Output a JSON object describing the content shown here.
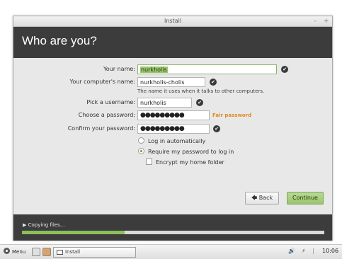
{
  "window": {
    "title": "Install",
    "minimize_glyph": "–",
    "close_glyph": "+"
  },
  "header": {
    "title": "Who are you?"
  },
  "form": {
    "name_label": "Your name:",
    "name_value": "nurkholis",
    "computer_label": "Your computer's name:",
    "computer_value": "nurkholis-cholis",
    "computer_hint": "The name it uses when it talks to other computers.",
    "username_label": "Pick a username:",
    "username_value": "nurkholis",
    "password_label": "Choose a password:",
    "password_value": "●●●●●●●●●",
    "password_strength": "Fair password",
    "confirm_label": "Confirm your password:",
    "confirm_value": "●●●●●●●●●",
    "login_auto_label": "Log in automatically",
    "login_require_label": "Require my password to log in",
    "encrypt_label": "Encrypt my home folder",
    "selected_login_option": "require_password",
    "encrypt_checked": false,
    "check_glyph": "✔"
  },
  "buttons": {
    "back_label": "Back",
    "back_glyph": "🡄",
    "continue_label": "Continue"
  },
  "status": {
    "text": "Copying files...",
    "arrow_glyph": "▶",
    "progress": 0.34
  },
  "taskbar": {
    "menu_label": "Menu",
    "window_label": "Install",
    "clock": "10:06",
    "volume_glyph": "🔊",
    "network_glyph": "⚡"
  },
  "colors": {
    "header_bg": "#3c3c3c",
    "accent_green": "#9cc46f",
    "strength_orange": "#e08a1e"
  }
}
